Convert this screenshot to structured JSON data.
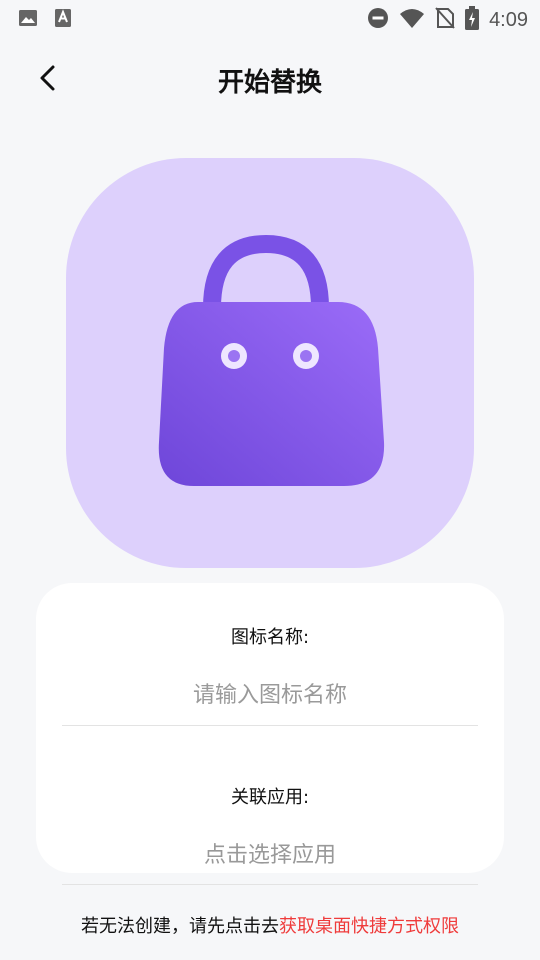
{
  "status_bar": {
    "time": "4:09",
    "icons": [
      "image-icon",
      "font-a-icon",
      "do-not-disturb-icon",
      "wifi-icon",
      "no-sim-icon",
      "battery-charging-icon"
    ]
  },
  "header": {
    "title": "开始替换",
    "back_icon": "chevron-left-icon"
  },
  "preview": {
    "icon": "shopping-bag-icon",
    "background_color": "#ddd0fc",
    "icon_color": "#7b52e8"
  },
  "form": {
    "icon_name_label": "图标名称:",
    "icon_name_placeholder": "请输入图标名称",
    "icon_name_value": "",
    "app_label": "关联应用:",
    "app_placeholder": "点击选择应用"
  },
  "footer": {
    "note_prefix": "若无法创建，请先点击去",
    "note_link": "获取桌面快捷方式权限",
    "link_color": "#ef3b3b"
  }
}
